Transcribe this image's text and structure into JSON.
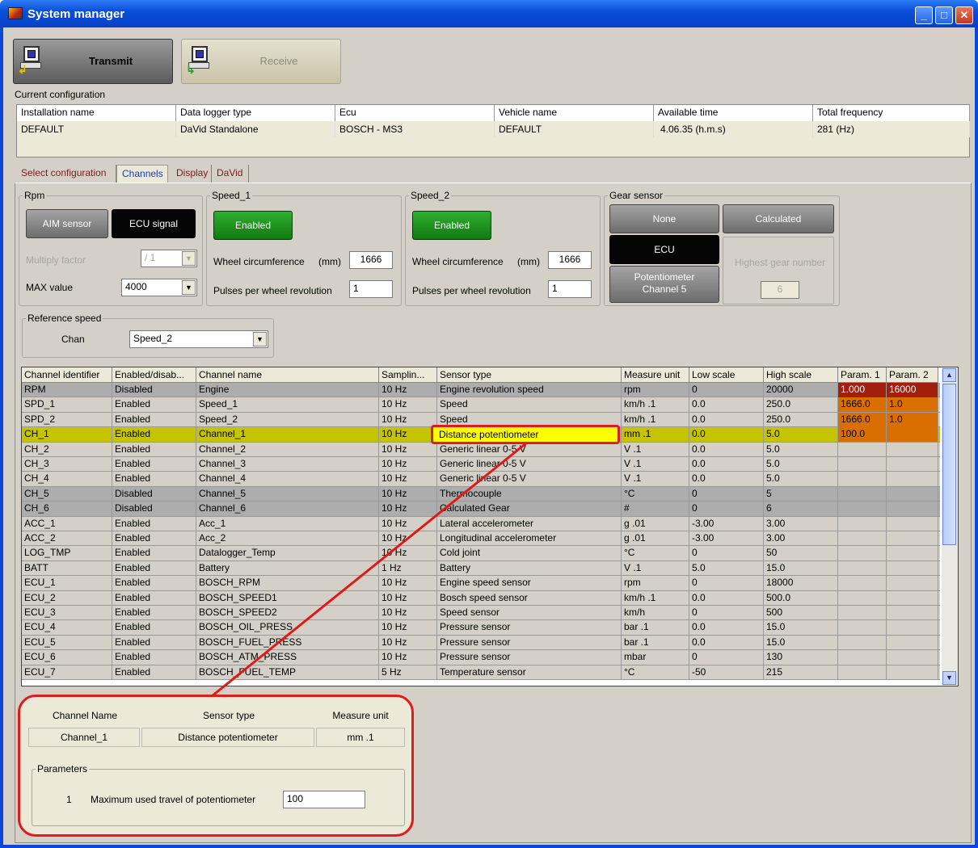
{
  "window": {
    "title": "System manager",
    "minimize": "_",
    "maximize": "□",
    "close": "✕"
  },
  "toolbar": {
    "transmit": "Transmit",
    "receive": "Receive"
  },
  "current_configuration": {
    "label": "Current configuration",
    "headers": [
      "Installation name",
      "Data logger type",
      "Ecu",
      "Vehicle name",
      "Available time",
      "Total frequency"
    ],
    "values": [
      "DEFAULT",
      "DaVid Standalone",
      "BOSCH - MS3",
      "DEFAULT",
      "4.06.35 (h.m.s)",
      "281 (Hz)"
    ]
  },
  "tabs": [
    "Select configuration",
    "Channels",
    "Display",
    "DaVid"
  ],
  "rpm": {
    "legend": "Rpm",
    "aim_sensor": "AIM sensor",
    "ecu_signal": "ECU signal",
    "multiply_label": "Multiply factor",
    "multiply_value": "/ 1",
    "max_label": "MAX value",
    "max_value": "4000"
  },
  "speed1": {
    "legend": "Speed_1",
    "enabled": "Enabled",
    "circ_label": "Wheel circumference",
    "unit": "(mm)",
    "circ_value": "1666",
    "pulses_label": "Pulses per wheel revolution",
    "pulses_value": "1"
  },
  "speed2": {
    "legend": "Speed_2",
    "enabled": "Enabled",
    "circ_label": "Wheel circumference",
    "unit": "(mm)",
    "circ_value": "1666",
    "pulses_label": "Pulses per wheel revolution",
    "pulses_value": "1"
  },
  "gear": {
    "legend": "Gear sensor",
    "none": "None",
    "calculated": "Calculated",
    "ecu": "ECU",
    "potentiometer": "Potentiometer\nChannel 5",
    "highest_label": "Highest gear number",
    "highest_value": "6"
  },
  "ref_speed": {
    "legend": "Reference speed",
    "chan_label": "Chan",
    "chan_value": "Speed_2"
  },
  "grid": {
    "headers": [
      "Channel identifier",
      "Enabled/disab...",
      "Channel name",
      "Samplin...",
      "Sensor type",
      "Measure unit",
      "Low scale",
      "High scale",
      "Param. 1",
      "Param. 2"
    ],
    "rows": [
      [
        "RPM",
        "Disabled",
        "Engine",
        "10 Hz",
        "Engine revolution speed",
        "rpm",
        "0",
        "20000",
        "1.000",
        "16000"
      ],
      [
        "SPD_1",
        "Enabled",
        "Speed_1",
        "10 Hz",
        "Speed",
        "km/h .1",
        "0.0",
        "250.0",
        "1666.0",
        "1.0"
      ],
      [
        "SPD_2",
        "Enabled",
        "Speed_2",
        "10 Hz",
        "Speed",
        "km/h .1",
        "0.0",
        "250.0",
        "1666.0",
        "1.0"
      ],
      [
        "CH_1",
        "Enabled",
        "Channel_1",
        "10 Hz",
        "Distance potentiometer",
        "mm .1",
        "0.0",
        "5.0",
        "100.0",
        ""
      ],
      [
        "CH_2",
        "Enabled",
        "Channel_2",
        "10 Hz",
        "Generic linear 0-5 V",
        "V .1",
        "0.0",
        "5.0",
        "",
        ""
      ],
      [
        "CH_3",
        "Enabled",
        "Channel_3",
        "10 Hz",
        "Generic linear 0-5 V",
        "V .1",
        "0.0",
        "5.0",
        "",
        ""
      ],
      [
        "CH_4",
        "Enabled",
        "Channel_4",
        "10 Hz",
        "Generic linear 0-5 V",
        "V .1",
        "0.0",
        "5.0",
        "",
        ""
      ],
      [
        "CH_5",
        "Disabled",
        "Channel_5",
        "10 Hz",
        "Thermocouple",
        "°C",
        "0",
        "5",
        "",
        ""
      ],
      [
        "CH_6",
        "Disabled",
        "Channel_6",
        "10 Hz",
        "Calculated Gear",
        "#",
        "0",
        "6",
        "",
        ""
      ],
      [
        "ACC_1",
        "Enabled",
        "Acc_1",
        "10 Hz",
        "Lateral accelerometer",
        "g .01",
        "-3.00",
        "3.00",
        "",
        ""
      ],
      [
        "ACC_2",
        "Enabled",
        "Acc_2",
        "10 Hz",
        "Longitudinal accelerometer",
        "g .01",
        "-3.00",
        "3.00",
        "",
        ""
      ],
      [
        "LOG_TMP",
        "Enabled",
        "Datalogger_Temp",
        "10 Hz",
        "Cold joint",
        "°C",
        "0",
        "50",
        "",
        ""
      ],
      [
        "BATT",
        "Enabled",
        "Battery",
        "1 Hz",
        "Battery",
        "V .1",
        "5.0",
        "15.0",
        "",
        ""
      ],
      [
        "ECU_1",
        "Enabled",
        "BOSCH_RPM",
        "10 Hz",
        "Engine speed sensor",
        "rpm",
        "0",
        "18000",
        "",
        ""
      ],
      [
        "ECU_2",
        "Enabled",
        "BOSCH_SPEED1",
        "10 Hz",
        "Bosch speed sensor",
        "km/h .1",
        "0.0",
        "500.0",
        "",
        ""
      ],
      [
        "ECU_3",
        "Enabled",
        "BOSCH_SPEED2",
        "10 Hz",
        "Speed sensor",
        "km/h",
        "0",
        "500",
        "",
        ""
      ],
      [
        "ECU_4",
        "Enabled",
        "BOSCH_OIL_PRESS",
        "10 Hz",
        "Pressure sensor",
        "bar .1",
        "0.0",
        "15.0",
        "",
        ""
      ],
      [
        "ECU_5",
        "Enabled",
        "BOSCH_FUEL_PRESS",
        "10 Hz",
        "Pressure sensor",
        "bar .1",
        "0.0",
        "15.0",
        "",
        ""
      ],
      [
        "ECU_6",
        "Enabled",
        "BOSCH_ATM_PRESS",
        "10 Hz",
        "Pressure sensor",
        "mbar",
        "0",
        "130",
        "",
        ""
      ],
      [
        "ECU_7",
        "Enabled",
        "BOSCH_FUEL_TEMP",
        "5 Hz",
        "Temperature sensor",
        "°C",
        "-50",
        "215",
        "",
        ""
      ]
    ]
  },
  "scroll": {
    "up": "▲",
    "down": "▼"
  },
  "callout": {
    "headers": [
      "Channel Name",
      "Sensor type",
      "Measure unit"
    ],
    "values": [
      "Channel_1",
      "Distance potentiometer",
      "mm .1"
    ],
    "params_legend": "Parameters",
    "param_index": "1",
    "param_label": "Maximum used travel of potentiometer",
    "param_value": "100"
  },
  "colors": {
    "title_blue": "#0a4fd8",
    "selected_row": "#c4c400",
    "param_orange": "#d96f00",
    "param_darkred": "#a21f0c",
    "highlight_red": "#dd1c1c"
  }
}
